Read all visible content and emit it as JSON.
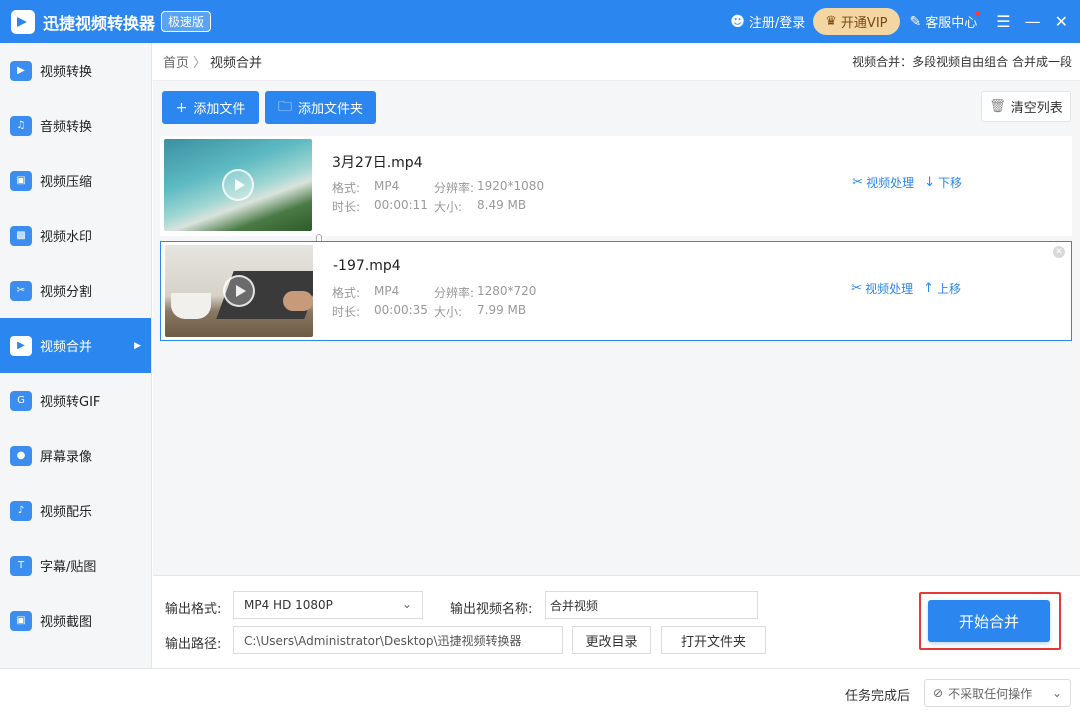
{
  "app": {
    "title": "迅捷视频转换器",
    "edition": "极速版",
    "login": "注册/登录",
    "vip": "开通VIP",
    "support": "客服中心",
    "menu_icon": "hamburger-icon",
    "minimize_icon": "minimize-icon",
    "close_icon": "close-icon"
  },
  "sidebar": {
    "items": [
      {
        "label": "视频转换",
        "icon": "video-convert-icon"
      },
      {
        "label": "音频转换",
        "icon": "audio-convert-icon"
      },
      {
        "label": "视频压缩",
        "icon": "video-compress-icon"
      },
      {
        "label": "视频水印",
        "icon": "video-watermark-icon"
      },
      {
        "label": "视频分割",
        "icon": "video-split-icon"
      },
      {
        "label": "视频合并",
        "icon": "video-merge-icon",
        "active": true
      },
      {
        "label": "视频转GIF",
        "icon": "gif-icon"
      },
      {
        "label": "屏幕录像",
        "icon": "screen-record-icon"
      },
      {
        "label": "视频配乐",
        "icon": "music-icon"
      },
      {
        "label": "字幕/贴图",
        "icon": "subtitle-icon"
      },
      {
        "label": "视频截图",
        "icon": "screenshot-icon"
      }
    ]
  },
  "breadcrumb": {
    "home": "首页",
    "separator": "〉",
    "current": "视频合并",
    "description": "视频合并：多段视频自由组合 合并成一段"
  },
  "toolbar": {
    "add_file": "添加文件",
    "add_folder": "添加文件夹",
    "clear_list": "清空列表"
  },
  "videos": [
    {
      "name": "3月27日.mp4",
      "format_label": "格式:",
      "format": "MP4",
      "resolution_label": "分辨率:",
      "resolution": "1920*1080",
      "duration_label": "时长:",
      "duration": "00:00:11",
      "size_label": "大小:",
      "size": "8.49 MB",
      "process": "视频处理",
      "move": "下移",
      "move_icon": "arrow-down-icon"
    },
    {
      "name": "-197.mp4",
      "format_label": "格式:",
      "format": "MP4",
      "resolution_label": "分辨率:",
      "resolution": "1280*720",
      "duration_label": "时长:",
      "duration": "00:00:35",
      "size_label": "大小:",
      "size": "7.99 MB",
      "process": "视频处理",
      "move": "上移",
      "move_icon": "arrow-up-icon"
    }
  ],
  "settings": {
    "output_format_label": "输出格式:",
    "output_format": "MP4  HD 1080P",
    "output_name_label": "输出视频名称:",
    "output_name": "合并视频",
    "output_path_label": "输出路径:",
    "output_path": "C:\\Users\\Administrator\\Desktop\\迅捷视频转换器",
    "change_dir": "更改目录",
    "open_folder": "打开文件夹",
    "start": "开始合并"
  },
  "footer": {
    "after_task_label": "任务完成后",
    "after_task_value": "不采取任何操作"
  },
  "colors": {
    "primary": "#2B86F0",
    "highlight_border": "#e53935",
    "vip_bg": "#F3D6A2"
  }
}
